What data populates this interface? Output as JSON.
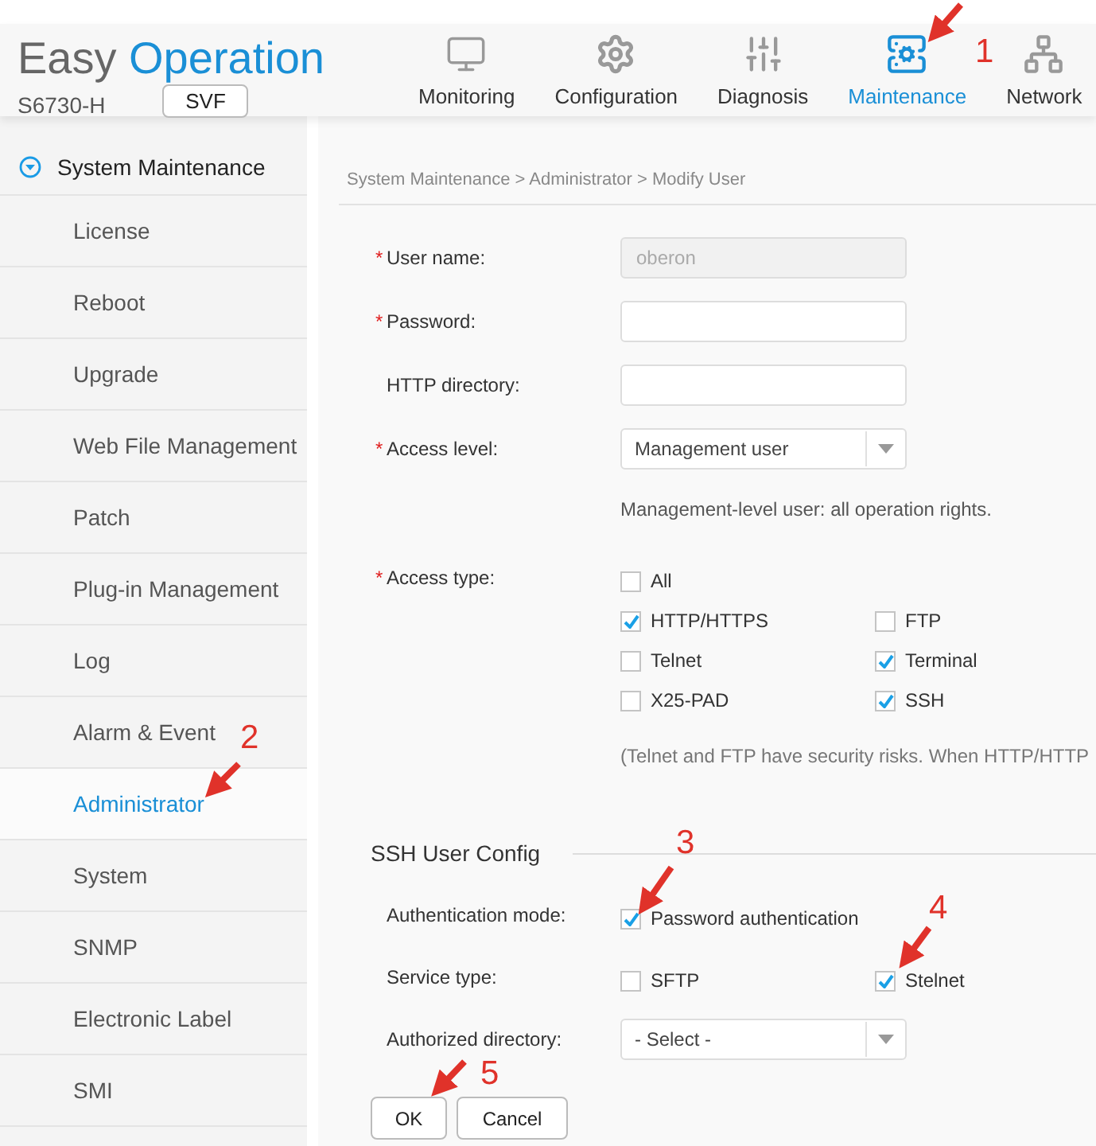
{
  "header": {
    "logo_prefix": "Easy",
    "logo_suffix": "Operation",
    "model": "S6730-H",
    "mode_button": "SVF",
    "nav": [
      {
        "label": "Monitoring",
        "selected": false
      },
      {
        "label": "Configuration",
        "selected": false
      },
      {
        "label": "Diagnosis",
        "selected": false
      },
      {
        "label": "Maintenance",
        "selected": true
      },
      {
        "label": "Network",
        "selected": false
      }
    ]
  },
  "sidebar": {
    "group": {
      "label": "System Maintenance",
      "expanded": true
    },
    "items": [
      {
        "label": "License",
        "selected": false
      },
      {
        "label": "Reboot",
        "selected": false
      },
      {
        "label": "Upgrade",
        "selected": false
      },
      {
        "label": "Web File Management",
        "selected": false
      },
      {
        "label": "Patch",
        "selected": false
      },
      {
        "label": "Plug-in Management",
        "selected": false
      },
      {
        "label": "Log",
        "selected": false
      },
      {
        "label": "Alarm & Event",
        "selected": false
      },
      {
        "label": "Administrator",
        "selected": true
      },
      {
        "label": "System",
        "selected": false
      },
      {
        "label": "SNMP",
        "selected": false
      },
      {
        "label": "Electronic Label",
        "selected": false
      },
      {
        "label": "SMI",
        "selected": false
      }
    ]
  },
  "breadcrumb": "System Maintenance > Administrator > Modify User",
  "form": {
    "rows": [
      {
        "kind": "input",
        "label": "User name:",
        "required_mark": "*",
        "value": "oberon",
        "disabled": true
      },
      {
        "kind": "input",
        "label": "Password:",
        "required_mark": "*",
        "disabled": false
      },
      {
        "kind": "input",
        "label": "HTTP directory:",
        "disabled": false
      },
      {
        "kind": "select",
        "label": "Access level:",
        "required_mark": "*",
        "value": "Management user"
      },
      {
        "kind": "hint",
        "text": "Management-level user: all operation rights."
      },
      {
        "kind": "checks",
        "label": "Access type:",
        "required_mark": "*",
        "options": [
          [
            {
              "label": "All",
              "checked": false
            }
          ],
          [
            {
              "label": "HTTP/HTTPS",
              "checked": true
            },
            {
              "label": "FTP",
              "checked": false
            }
          ],
          [
            {
              "label": "Telnet",
              "checked": false
            },
            {
              "label": "Terminal",
              "checked": true
            }
          ],
          [
            {
              "label": "X25-PAD",
              "checked": false
            },
            {
              "label": "SSH",
              "checked": true
            }
          ]
        ]
      },
      {
        "kind": "note",
        "text": "(Telnet and FTP have security risks. When HTTP/HTTP"
      }
    ]
  },
  "ssh": {
    "title": "SSH User Config",
    "rows": [
      {
        "kind": "checks",
        "label": "Authentication mode:",
        "options": [
          [
            {
              "label": "Password authentication",
              "checked": true
            }
          ]
        ]
      },
      {
        "kind": "checks",
        "label": "Service type:",
        "options": [
          [
            {
              "label": "SFTP",
              "checked": false
            },
            {
              "label": "Stelnet",
              "checked": true
            }
          ]
        ]
      },
      {
        "kind": "select",
        "label": "Authorized directory:",
        "placeholder": "- Select -"
      }
    ]
  },
  "buttons": [
    {
      "label": "OK"
    },
    {
      "label": "Cancel"
    }
  ],
  "annotations": [
    {
      "number": "1"
    },
    {
      "number": "2"
    },
    {
      "number": "3"
    },
    {
      "number": "4"
    },
    {
      "number": "5"
    }
  ]
}
